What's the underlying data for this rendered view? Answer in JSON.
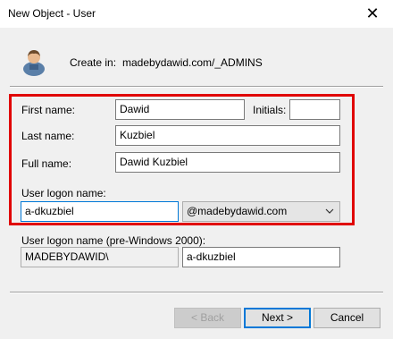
{
  "window": {
    "title": "New Object - User",
    "close_glyph": "✕"
  },
  "header": {
    "create_in_label": "Create in:",
    "create_in_path": "madebydawid.com/_ADMINS",
    "icon": "user-icon"
  },
  "form": {
    "first_name_label": "First name:",
    "first_name_value": "Dawid",
    "initials_label": "Initials:",
    "initials_value": "",
    "last_name_label": "Last name:",
    "last_name_value": "Kuzbiel",
    "full_name_label": "Full name:",
    "full_name_value": "Dawid Kuzbiel",
    "logon_label": "User logon name:",
    "logon_value": "a-dkuzbiel",
    "domain_value": "@madebydawid.com",
    "pre2000_label": "User logon name (pre-Windows 2000):",
    "pre2000_domain": "MADEBYDAWID\\",
    "pre2000_value": "a-dkuzbiel"
  },
  "buttons": {
    "back": "< Back",
    "next": "Next >",
    "cancel": "Cancel"
  },
  "colors": {
    "highlight_box": "#e00000",
    "focus_border": "#0078d7"
  }
}
